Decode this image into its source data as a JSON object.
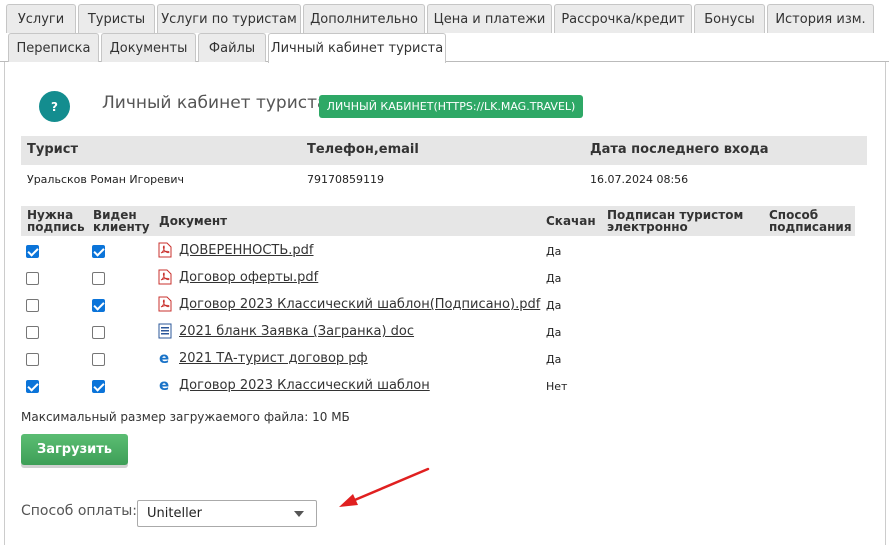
{
  "tabs_row1": [
    "Услуги",
    "Туристы",
    "Услуги по туристам",
    "Дополнительно",
    "Цена и платежи",
    "Рассрочка/кредит",
    "Бонусы",
    "История изм."
  ],
  "tabs_row2": [
    "Переписка",
    "Документы",
    "Файлы",
    "Личный кабинет туриста"
  ],
  "active_tab": "Личный кабинет туриста",
  "help": {
    "label": "?"
  },
  "heading": "Личный кабинет туриста",
  "lk_button": "ЛИЧНЫЙ КАБИНЕТ(HTTPS://LK.MAG.TRAVEL)",
  "tourist_table": {
    "headers": [
      "Турист",
      "Телефон,email",
      "Дата последнего входа"
    ],
    "row": [
      "Уральсков Роман Игоревич",
      "79170859119",
      "16.07.2024 08:56"
    ]
  },
  "documents_table": {
    "headers": {
      "need_sign": [
        "Нужна",
        "подпись"
      ],
      "visible": [
        "Виден",
        "клиенту"
      ],
      "document": "Документ",
      "downloaded": "Скачан",
      "signed": [
        "Подписан туристом",
        "электронно"
      ],
      "method": [
        "Способ",
        "подписания"
      ]
    },
    "rows": [
      {
        "need_sign": true,
        "visible": true,
        "icon": "pdf-icon",
        "name": "ДОВЕРЕННОСТЬ.pdf",
        "downloaded": "Да"
      },
      {
        "need_sign": false,
        "visible": false,
        "icon": "pdf-icon",
        "name": "Договор оферты.pdf",
        "downloaded": "Да"
      },
      {
        "need_sign": false,
        "visible": true,
        "icon": "pdf-icon",
        "name": "Договор 2023 Классический шаблон(Подписано).pdf",
        "downloaded": "Да"
      },
      {
        "need_sign": false,
        "visible": false,
        "icon": "word-doc-icon",
        "name": "2021 бланк Заявка (Загранка) doc",
        "downloaded": "Да"
      },
      {
        "need_sign": false,
        "visible": false,
        "icon": "edge-browser-icon",
        "name": "2021 ТА-турист договор рф",
        "downloaded": "Да"
      },
      {
        "need_sign": true,
        "visible": true,
        "icon": "edge-browser-icon",
        "name": "Договор 2023 Классический шаблон",
        "downloaded": "Нет"
      }
    ]
  },
  "max_size_text": "Максимальный размер загружаемого файла: 10 МБ",
  "upload_button": "Загрузить",
  "payment": {
    "label": "Способ оплаты:",
    "selected": "Uniteller"
  },
  "colors": {
    "accent_green": "#2ea866",
    "help_teal": "#138d8f",
    "checkbox_blue": "#0b74d9",
    "arrow_red": "#e02020"
  }
}
